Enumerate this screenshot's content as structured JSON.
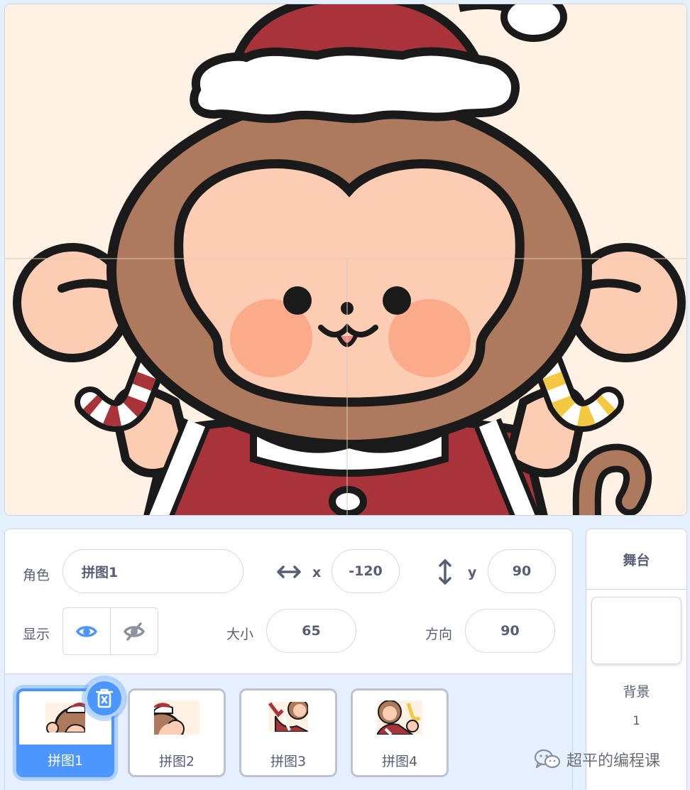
{
  "sprite_info": {
    "sprite_label": "角色",
    "sprite_name": "拼图1",
    "x_label": "x",
    "x_value": "-120",
    "y_label": "y",
    "y_value": "90",
    "show_label": "显示",
    "size_label": "大小",
    "size_value": "65",
    "direction_label": "方向",
    "direction_value": "90"
  },
  "sprites": [
    {
      "name": "拼图1",
      "selected": true
    },
    {
      "name": "拼图2",
      "selected": false
    },
    {
      "name": "拼图3",
      "selected": false
    },
    {
      "name": "拼图4",
      "selected": false
    }
  ],
  "stage_panel": {
    "title": "舞台",
    "backdrop_label": "背景",
    "backdrop_count": "1"
  },
  "watermark": "超平的编程课",
  "colors": {
    "accent": "#4c97ff",
    "stage_bg": "#fff1e3",
    "monkey_fur": "#ad7a5e",
    "monkey_face": "#fdcdb3",
    "hat_red": "#a8333a"
  },
  "icons": [
    "delete-icon",
    "eye-icon",
    "eye-slash-icon",
    "horizontal-arrow-icon",
    "vertical-arrow-icon",
    "wechat-icon"
  ]
}
